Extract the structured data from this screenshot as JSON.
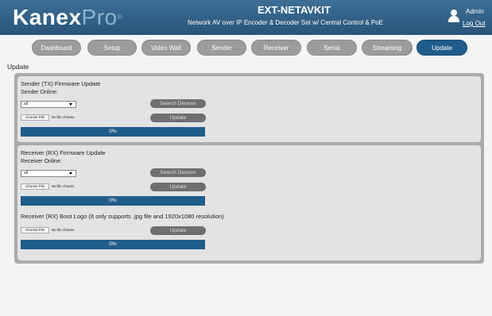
{
  "header": {
    "logo_main": "Kanex",
    "logo_suffix": "Pro",
    "title": "EXT-NETAVKIT",
    "subtitle": "Network AV over IP Encoder & Decoder Set w/ Central Control & PoE",
    "user_label": "Admin",
    "logout_label": "Log Out",
    "user_icon": "user-icon"
  },
  "nav": {
    "items": [
      {
        "label": "Dashboard",
        "active": false
      },
      {
        "label": "Setup",
        "active": false
      },
      {
        "label": "Video Wall",
        "active": false
      },
      {
        "label": "Sender",
        "active": false
      },
      {
        "label": "Receiver",
        "active": false
      },
      {
        "label": "Serial",
        "active": false
      },
      {
        "label": "Streaming",
        "active": false
      },
      {
        "label": "Update",
        "active": true
      }
    ]
  },
  "page_title": "Update",
  "sender_tx": {
    "title": "Sender (TX) Firmware Update",
    "online_label": "Sender Online:",
    "select_value": "all",
    "search_label": "Search Devices",
    "choose_label": "Choose File",
    "no_file": "No file chosen",
    "update_label": "Update",
    "progress": "0%",
    "progress_value": 0
  },
  "receiver_rx": {
    "title": "Receiver (RX) Firmware Update",
    "online_label": "Receiver Online:",
    "select_value": "all",
    "search_label": "Search Devices",
    "choose_label": "Choose File",
    "no_file": "No file chosen",
    "update_label": "Update",
    "progress": "0%",
    "progress_value": 0
  },
  "boot_logo": {
    "title": "Receiver (RX) Boot Logo (It only supports .jpg file and 1920x1080 resolution)",
    "choose_label": "Choose File",
    "no_file": "No file chosen",
    "update_label": "Update",
    "progress": "0%",
    "progress_value": 0
  },
  "colors": {
    "header": "#2f5d83",
    "nav_active": "#215d8b",
    "nav_inactive": "#9c9c9c",
    "progress_bar": "#215d8b"
  }
}
